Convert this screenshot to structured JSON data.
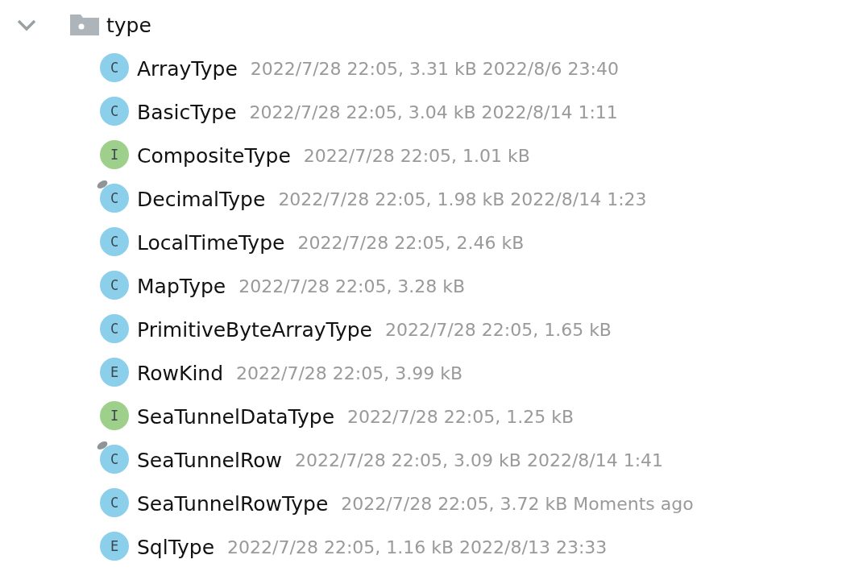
{
  "folder": {
    "name": "type",
    "expanded": true
  },
  "items": [
    {
      "kind": "class",
      "badge": "C",
      "abstract": false,
      "name": "ArrayType",
      "meta": "2022/7/28 22:05, 3.31 kB 2022/8/6 23:40"
    },
    {
      "kind": "class",
      "badge": "C",
      "abstract": false,
      "name": "BasicType",
      "meta": "2022/7/28 22:05, 3.04 kB 2022/8/14 1:11"
    },
    {
      "kind": "interface",
      "badge": "I",
      "abstract": false,
      "name": "CompositeType",
      "meta": "2022/7/28 22:05, 1.01 kB"
    },
    {
      "kind": "class",
      "badge": "C",
      "abstract": true,
      "name": "DecimalType",
      "meta": "2022/7/28 22:05, 1.98 kB 2022/8/14 1:23"
    },
    {
      "kind": "class",
      "badge": "C",
      "abstract": false,
      "name": "LocalTimeType",
      "meta": "2022/7/28 22:05, 2.46 kB"
    },
    {
      "kind": "class",
      "badge": "C",
      "abstract": false,
      "name": "MapType",
      "meta": "2022/7/28 22:05, 3.28 kB"
    },
    {
      "kind": "class",
      "badge": "C",
      "abstract": false,
      "name": "PrimitiveByteArrayType",
      "meta": "2022/7/28 22:05, 1.65 kB"
    },
    {
      "kind": "enum",
      "badge": "E",
      "abstract": false,
      "name": "RowKind",
      "meta": "2022/7/28 22:05, 3.99 kB"
    },
    {
      "kind": "interface",
      "badge": "I",
      "abstract": false,
      "name": "SeaTunnelDataType",
      "meta": "2022/7/28 22:05, 1.25 kB"
    },
    {
      "kind": "class",
      "badge": "C",
      "abstract": true,
      "name": "SeaTunnelRow",
      "meta": "2022/7/28 22:05, 3.09 kB 2022/8/14 1:41"
    },
    {
      "kind": "class",
      "badge": "C",
      "abstract": false,
      "name": "SeaTunnelRowType",
      "meta": "2022/7/28 22:05, 3.72 kB Moments ago"
    },
    {
      "kind": "enum",
      "badge": "E",
      "abstract": false,
      "name": "SqlType",
      "meta": "2022/7/28 22:05, 1.16 kB 2022/8/13 23:33"
    }
  ]
}
